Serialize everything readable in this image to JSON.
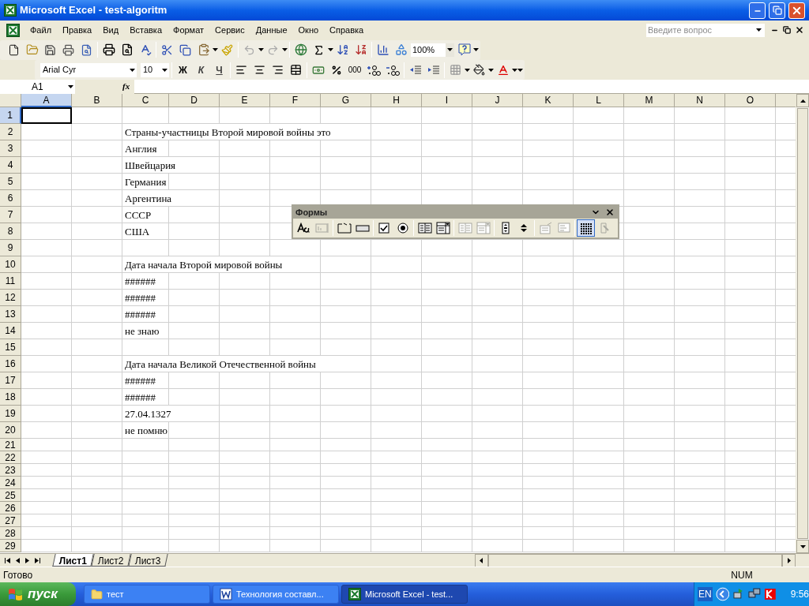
{
  "window": {
    "title": "Microsoft Excel - test-algoritm"
  },
  "menu": [
    "Файл",
    "Правка",
    "Вид",
    "Вставка",
    "Формат",
    "Сервис",
    "Данные",
    "Окно",
    "Справка"
  ],
  "help_box": {
    "placeholder": "Введите вопрос"
  },
  "standard_toolbar": {
    "zoom": "100%"
  },
  "formatting_toolbar": {
    "font": "Arial Cyr",
    "size": "10",
    "bold": "Ж",
    "italic": "К",
    "underline": "Ч",
    "thousands": "000"
  },
  "formula_bar": {
    "name_box": "A1",
    "function_label": "fx"
  },
  "columns": [
    {
      "label": "A",
      "selected": true
    },
    {
      "label": "B",
      "selected": false
    },
    {
      "label": "C",
      "selected": false
    },
    {
      "label": "D",
      "selected": false
    },
    {
      "label": "E",
      "selected": false
    },
    {
      "label": "F",
      "selected": false
    },
    {
      "label": "G",
      "selected": false
    },
    {
      "label": "H",
      "selected": false
    },
    {
      "label": "I",
      "selected": false
    },
    {
      "label": "J",
      "selected": false
    },
    {
      "label": "K",
      "selected": false
    },
    {
      "label": "L",
      "selected": false
    },
    {
      "label": "M",
      "selected": false
    },
    {
      "label": "N",
      "selected": false
    },
    {
      "label": "O",
      "selected": false
    }
  ],
  "rows": [
    {
      "label": "1",
      "selected": true
    },
    {
      "label": "2",
      "selected": false,
      "column_c": "Страны-участницы Второй мировой войны это"
    },
    {
      "label": "3",
      "selected": false,
      "column_c": "Англия"
    },
    {
      "label": "4",
      "selected": false,
      "column_c": "Швейцария"
    },
    {
      "label": "5",
      "selected": false,
      "column_c": "Германия"
    },
    {
      "label": "6",
      "selected": false,
      "column_c": "Аргентина"
    },
    {
      "label": "7",
      "selected": false,
      "column_c": "СССР"
    },
    {
      "label": "8",
      "selected": false,
      "column_c": "США"
    },
    {
      "label": "9",
      "selected": false
    },
    {
      "label": "10",
      "selected": false,
      "column_c": "Дата начала Второй мировой войны"
    },
    {
      "label": "11",
      "selected": false,
      "column_c": "######"
    },
    {
      "label": "12",
      "selected": false,
      "column_c": "######"
    },
    {
      "label": "13",
      "selected": false,
      "column_c": "######"
    },
    {
      "label": "14",
      "selected": false,
      "column_c": "не знаю"
    },
    {
      "label": "15",
      "selected": false
    },
    {
      "label": "16",
      "selected": false,
      "column_c": "Дата начала Великой Отечественной войны"
    },
    {
      "label": "17",
      "selected": false,
      "column_c": "######"
    },
    {
      "label": "18",
      "selected": false,
      "column_c": "######"
    },
    {
      "label": "19",
      "selected": false,
      "column_c": "27.04.1327"
    },
    {
      "label": "20",
      "selected": false,
      "column_c": "не помню"
    },
    {
      "label": "21",
      "selected": false
    },
    {
      "label": "22",
      "selected": false
    },
    {
      "label": "23",
      "selected": false
    },
    {
      "label": "24",
      "selected": false
    },
    {
      "label": "25",
      "selected": false
    },
    {
      "label": "26",
      "selected": false
    },
    {
      "label": "27",
      "selected": false
    },
    {
      "label": "28",
      "selected": false
    },
    {
      "label": "29",
      "selected": false
    }
  ],
  "forms_toolbar": {
    "title": "Формы",
    "tools": [
      {
        "kind": "label",
        "disabled": false,
        "selected": false
      },
      {
        "kind": "edit_box",
        "disabled": true,
        "selected": false
      },
      {
        "kind": "group_box",
        "disabled": false,
        "selected": false
      },
      {
        "kind": "button",
        "disabled": false,
        "selected": false
      },
      {
        "kind": "checkbox",
        "disabled": false,
        "selected": false
      },
      {
        "kind": "option",
        "disabled": false,
        "selected": false
      },
      {
        "kind": "list_box",
        "disabled": false,
        "selected": false
      },
      {
        "kind": "combo_box",
        "disabled": false,
        "selected": false
      },
      {
        "kind": "list_box",
        "disabled": true,
        "selected": false
      },
      {
        "kind": "combo_box",
        "disabled": true,
        "selected": false
      },
      {
        "kind": "scroll_bar",
        "disabled": false,
        "selected": false
      },
      {
        "kind": "spinner",
        "disabled": false,
        "selected": false
      },
      {
        "kind": "properties",
        "disabled": true,
        "selected": false
      },
      {
        "kind": "code",
        "disabled": true,
        "selected": false
      },
      {
        "kind": "grid",
        "disabled": false,
        "selected": true
      },
      {
        "kind": "run",
        "disabled": true,
        "selected": false
      }
    ]
  },
  "sheet_tabs": [
    {
      "label": "Лист1",
      "selected": true
    },
    {
      "label": "Лист2",
      "selected": false
    },
    {
      "label": "Лист3",
      "selected": false
    }
  ],
  "status_bar": {
    "text": "Готово",
    "num": "NUM"
  },
  "taskbar": {
    "start": "пуск",
    "tasks": [
      {
        "label": "тест",
        "kind": "folder",
        "selected": false
      },
      {
        "label": "Технология составл...",
        "kind": "word",
        "selected": false
      },
      {
        "label": "Microsoft Excel - test...",
        "kind": "excel",
        "selected": true
      }
    ],
    "language": "EN",
    "clock": "9:56"
  }
}
